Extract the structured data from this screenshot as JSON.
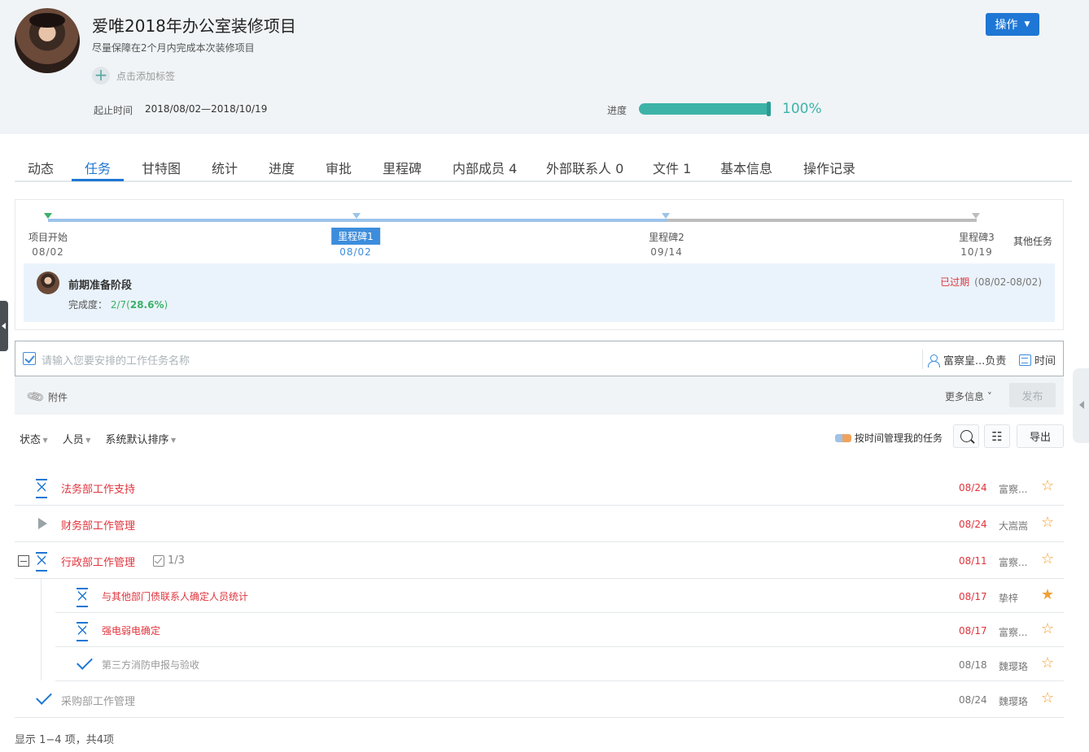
{
  "project": {
    "title": "爱唯2018年办公室装修项目",
    "subtitle": "尽量保障在2个月内完成本次装修项目",
    "add_tag": "点击添加标签",
    "time_label": "起止时间",
    "time_value": "2018/08/02—2018/10/19",
    "progress_label": "进度",
    "progress_value": 1.0,
    "progress_text": "100%",
    "action_button": "操作"
  },
  "tabs": [
    "动态",
    "任务",
    "甘特图",
    "统计",
    "进度",
    "审批",
    "里程碑",
    "内部成员 4",
    "外部联系人 0",
    "文件 1",
    "基本信息",
    "操作记录"
  ],
  "active_tab": "任务",
  "milestones": {
    "points": [
      {
        "name": "项目开始",
        "date": "08/02"
      },
      {
        "name": "里程碑1",
        "date": "08/02",
        "selected": true
      },
      {
        "name": "里程碑2",
        "date": "09/14"
      },
      {
        "name": "里程碑3",
        "date": "10/19"
      }
    ],
    "other_tasks": "其他任务",
    "phase": {
      "title": "前期准备阶段",
      "completion_label": "完成度：",
      "completion_ratio": "2/7(",
      "completion_pct": "28.6%",
      "completion_close": ")",
      "status": "已过期",
      "range": "(08/02-08/02)"
    }
  },
  "task_input": {
    "placeholder": "请输入您要安排的工作任务名称",
    "owner": "富察皇...负责",
    "time": "时间",
    "attachment": "附件",
    "more_info": "更多信息",
    "publish": "发布"
  },
  "toolbar": {
    "filters": [
      "状态",
      "人员",
      "系统默认排序"
    ],
    "time_manage": "按时间管理我的任务",
    "export": "导出"
  },
  "tasks": [
    {
      "name": "法务部工作支持",
      "status": "pending",
      "date": "08/24",
      "owner": "富察...",
      "starred": false,
      "name_color": "red",
      "date_color": "red"
    },
    {
      "name": "财务部工作管理",
      "status": "not-started",
      "date": "08/24",
      "owner": "大嵩嵩",
      "starred": false,
      "name_color": "red",
      "date_color": "red"
    },
    {
      "name": "行政部工作管理",
      "status": "pending",
      "date": "08/11",
      "owner": "富察...",
      "starred": false,
      "name_color": "red",
      "date_color": "red",
      "subtask_count": "1/3",
      "expanded": true,
      "subtasks": [
        {
          "name": "与其他部门债联系人确定人员统计",
          "status": "pending",
          "date": "08/17",
          "owner": "挚梓",
          "starred": true,
          "name_color": "red",
          "date_color": "red"
        },
        {
          "name": "强电弱电确定",
          "status": "pending",
          "date": "08/17",
          "owner": "富察...",
          "starred": false,
          "name_color": "red",
          "date_color": "red"
        },
        {
          "name": "第三方消防申报与验收",
          "status": "done",
          "date": "08/18",
          "owner": "魏璎珞",
          "starred": false,
          "name_color": "gray",
          "date_color": "gray"
        }
      ]
    },
    {
      "name": "采购部工作管理",
      "status": "done",
      "date": "08/24",
      "owner": "魏璎珞",
      "starred": false,
      "name_color": "gray",
      "date_color": "gray"
    }
  ],
  "footer": "显示 1−4 项，共4项"
}
